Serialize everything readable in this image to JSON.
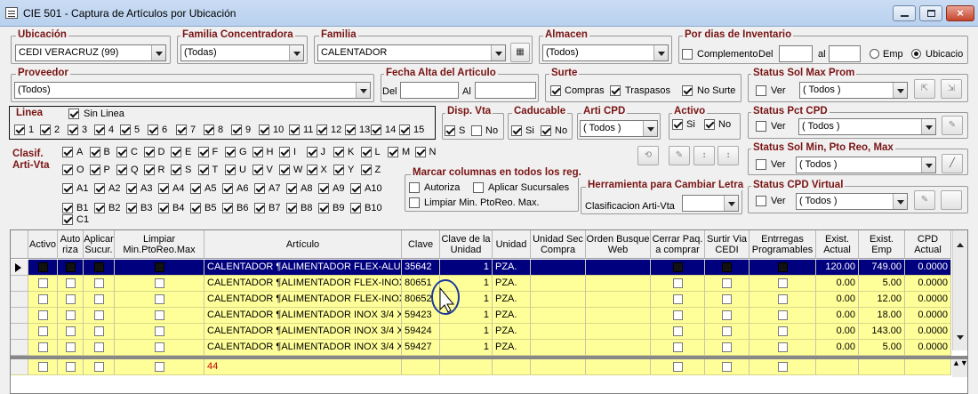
{
  "window": {
    "title": "CIE 501 - Captura de Artículos por Ubicación"
  },
  "ubicacion": {
    "label": "Ubicación",
    "value": "CEDI VERACRUZ (99)"
  },
  "familia_conc": {
    "label": "Familia Concentradora",
    "value": "(Todas)"
  },
  "familia": {
    "label": "Familia",
    "value": "CALENTADOR"
  },
  "almacen": {
    "label": "Almacen",
    "value": "(Todos)"
  },
  "por_dias": {
    "label": "Por dias de Inventario",
    "complemento": "Complemento",
    "del": "Del",
    "al": "al",
    "emp": "Emp",
    "ubicacion": "Ubicacio"
  },
  "proveedor": {
    "label": "Proveedor",
    "value": "(Todos)"
  },
  "fecha_alta": {
    "label": "Fecha Alta del Articulo",
    "del": "Del",
    "al": "Al"
  },
  "surte": {
    "label": "Surte",
    "compras": "Compras",
    "traspasos": "Traspasos",
    "no_surte": "No Surte"
  },
  "ssmp": {
    "label": "Status Sol Max Prom",
    "ver": "Ver",
    "value": "( Todos )"
  },
  "linea": {
    "label": "Linea",
    "sin_linea": "Sin Linea",
    "items": [
      "1",
      "2",
      "3",
      "4",
      "5",
      "6",
      "7",
      "8",
      "9",
      "10",
      "11",
      "12",
      "13",
      "14",
      "15"
    ]
  },
  "disp": {
    "label": "Disp. Vta",
    "s": "S",
    "no": "No"
  },
  "caducable": {
    "label": "Caducable",
    "si": "Si",
    "no": "No"
  },
  "arti_cpd": {
    "label": "Arti CPD",
    "value": "( Todos )"
  },
  "activo": {
    "label": "Activo",
    "si": "Si",
    "no": "No"
  },
  "spct": {
    "label": "Status Pct CPD",
    "ver": "Ver",
    "value": "( Todos )"
  },
  "clasif": {
    "label1": "Clasif.",
    "label2": "Arti-Vta",
    "row1": [
      "A",
      "B",
      "C",
      "D",
      "E",
      "F",
      "G",
      "H",
      "I",
      "J",
      "K",
      "L",
      "M",
      "N"
    ],
    "row2": [
      "O",
      "P",
      "Q",
      "R",
      "S",
      "T",
      "U",
      "V",
      "W",
      "X",
      "Y",
      "Z"
    ],
    "row3": [
      "A1",
      "A2",
      "A3",
      "A4",
      "A5",
      "A6",
      "A7",
      "A8",
      "A9",
      "A10"
    ],
    "row4": [
      "B1",
      "B2",
      "B3",
      "B4",
      "B5",
      "B6",
      "B7",
      "B8",
      "B9",
      "B10"
    ],
    "row5": [
      "C1"
    ]
  },
  "ssmin": {
    "label": "Status Sol Min, Pto Reo, Max",
    "ver": "Ver",
    "value": "( Todos )"
  },
  "marcar": {
    "label": "Marcar columnas en todos los reg.",
    "autoriza": "Autoriza",
    "aplicar": "Aplicar Sucursales",
    "limpiar": "Limpiar Min. PtoReo. Max."
  },
  "herr": {
    "label": "Herramienta para Cambiar Letra",
    "clasif": "Clasificacion Arti-Vta"
  },
  "scpdv": {
    "label": "Status CPD Virtual",
    "ver": "Ver",
    "value": "( Todos )"
  },
  "grid": {
    "headers": [
      "Activo",
      "Auto riza",
      "Aplicar Sucur.",
      "Limpiar Min.PtoReo.Max",
      "Artículo",
      "Clave",
      "Clave de la Unidad",
      "Unidad",
      "Unidad Sec Compra",
      "Orden Busque Web",
      "Cerrar Paq. a comprar",
      "Surtir Via CEDI",
      "Entrregas Programables",
      "Exist. Actual",
      "Exist. Emp",
      "CPD Actual"
    ],
    "rows": [
      {
        "articulo": "CALENTADOR ¶ALIMENTADOR FLEX-ALU",
        "clave": "35642",
        "cu": "1",
        "unidad": "PZA.",
        "ea": "120.00",
        "ee": "749.00",
        "cpd": "0.0000"
      },
      {
        "articulo": "CALENTADOR ¶ALIMENTADOR FLEX-INOX",
        "clave": "80651",
        "cu": "1",
        "unidad": "PZA.",
        "ea": "0.00",
        "ee": "5.00",
        "cpd": "0.0000"
      },
      {
        "articulo": "CALENTADOR ¶ALIMENTADOR FLEX-INOX",
        "clave": "80652",
        "cu": "1",
        "unidad": "PZA.",
        "ea": "0.00",
        "ee": "12.00",
        "cpd": "0.0000"
      },
      {
        "articulo": "CALENTADOR ¶ALIMENTADOR INOX 3/4 X",
        "clave": "59423",
        "cu": "1",
        "unidad": "PZA.",
        "ea": "0.00",
        "ee": "18.00",
        "cpd": "0.0000"
      },
      {
        "articulo": "CALENTADOR ¶ALIMENTADOR INOX 3/4 X",
        "clave": "59424",
        "cu": "1",
        "unidad": "PZA.",
        "ea": "0.00",
        "ee": "143.00",
        "cpd": "0.0000"
      },
      {
        "articulo": "CALENTADOR ¶ALIMENTADOR INOX 3/4 X",
        "clave": "59427",
        "cu": "1",
        "unidad": "PZA.",
        "ea": "0.00",
        "ee": "5.00",
        "cpd": "0.0000"
      }
    ],
    "total": "44"
  },
  "colors": {
    "selected_row": "#00007f",
    "row_bg": "#ffff99",
    "label_red": "#7a1414"
  }
}
